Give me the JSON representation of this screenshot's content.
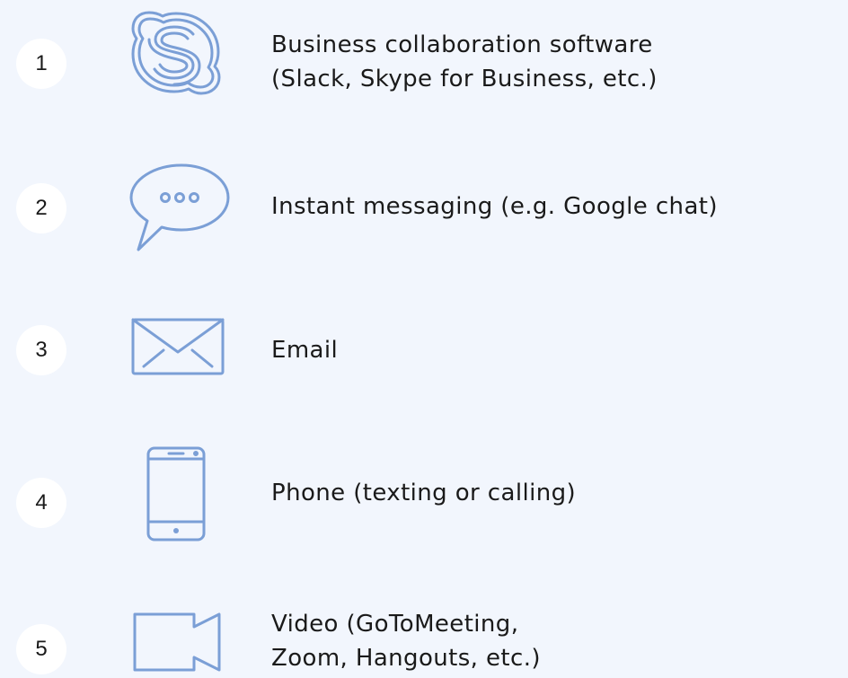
{
  "accent_color": "#7b9fd6",
  "items": [
    {
      "number": "1",
      "icon": "skype-icon",
      "label": "Business collaboration software\n(Slack, Skype for Business, etc.)"
    },
    {
      "number": "2",
      "icon": "chat-bubble-icon",
      "label": "Instant messaging (e.g. Google chat)"
    },
    {
      "number": "3",
      "icon": "envelope-icon",
      "label": "Email"
    },
    {
      "number": "4",
      "icon": "smartphone-icon",
      "label": "Phone (texting or calling)"
    },
    {
      "number": "5",
      "icon": "video-camera-icon",
      "label": "Video (GoToMeeting,\nZoom, Hangouts, etc.)"
    }
  ]
}
